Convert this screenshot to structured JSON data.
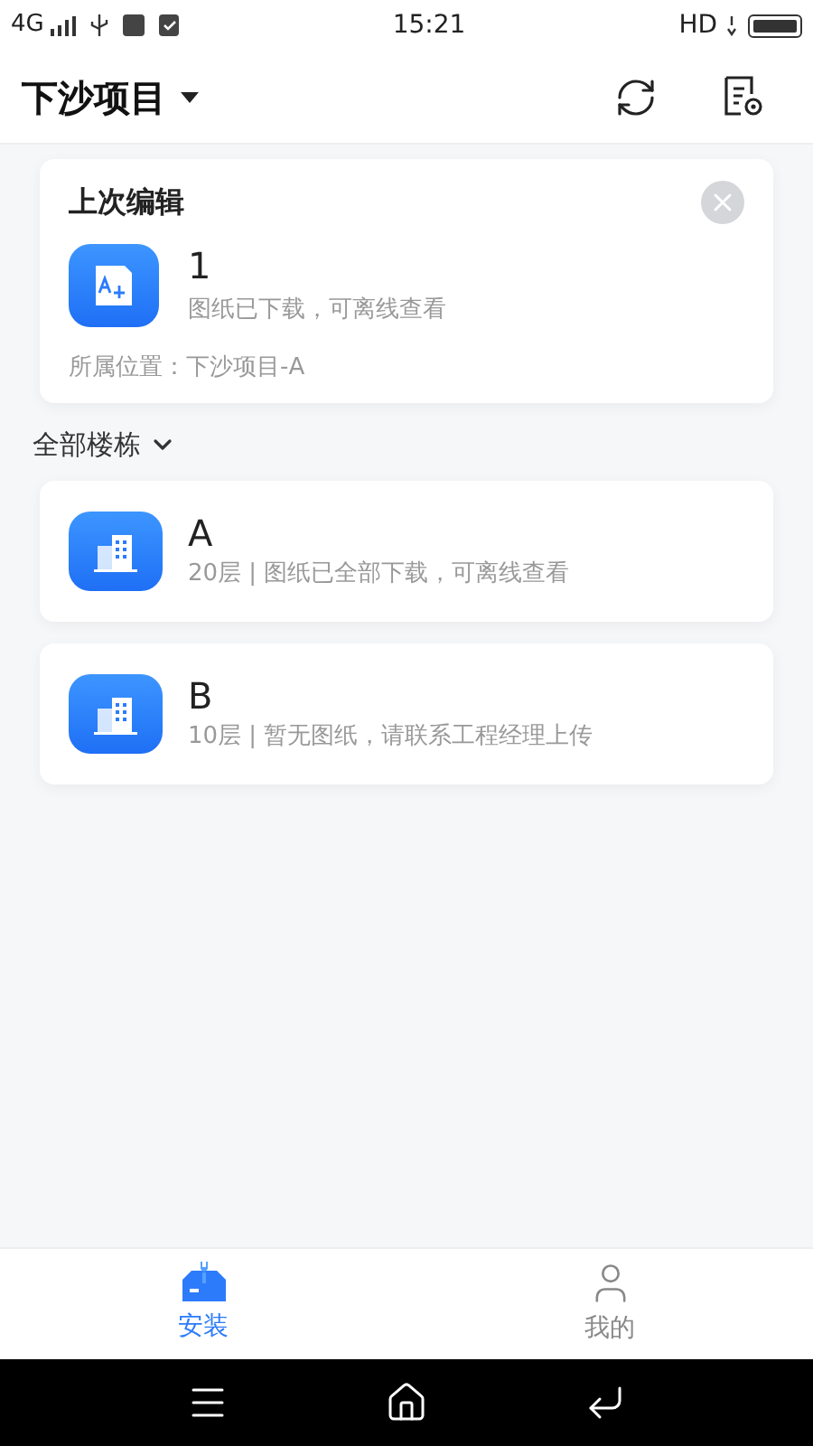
{
  "status_bar": {
    "network": "4G",
    "time": "15:21",
    "hd": "HD"
  },
  "header": {
    "title": "下沙项目"
  },
  "last_edit": {
    "title": "上次编辑",
    "name": "1",
    "status": "图纸已下载，可离线查看",
    "location": "所属位置：下沙项目-A"
  },
  "filter": {
    "label": "全部楼栋"
  },
  "buildings": [
    {
      "name": "A",
      "info": "20层 | 图纸已全部下载，可离线查看"
    },
    {
      "name": "B",
      "info": "10层 | 暂无图纸，请联系工程经理上传"
    }
  ],
  "tabs": [
    {
      "label": "安装",
      "kind": "install",
      "selected": true
    },
    {
      "label": "我的",
      "kind": "profile",
      "selected": false
    }
  ]
}
